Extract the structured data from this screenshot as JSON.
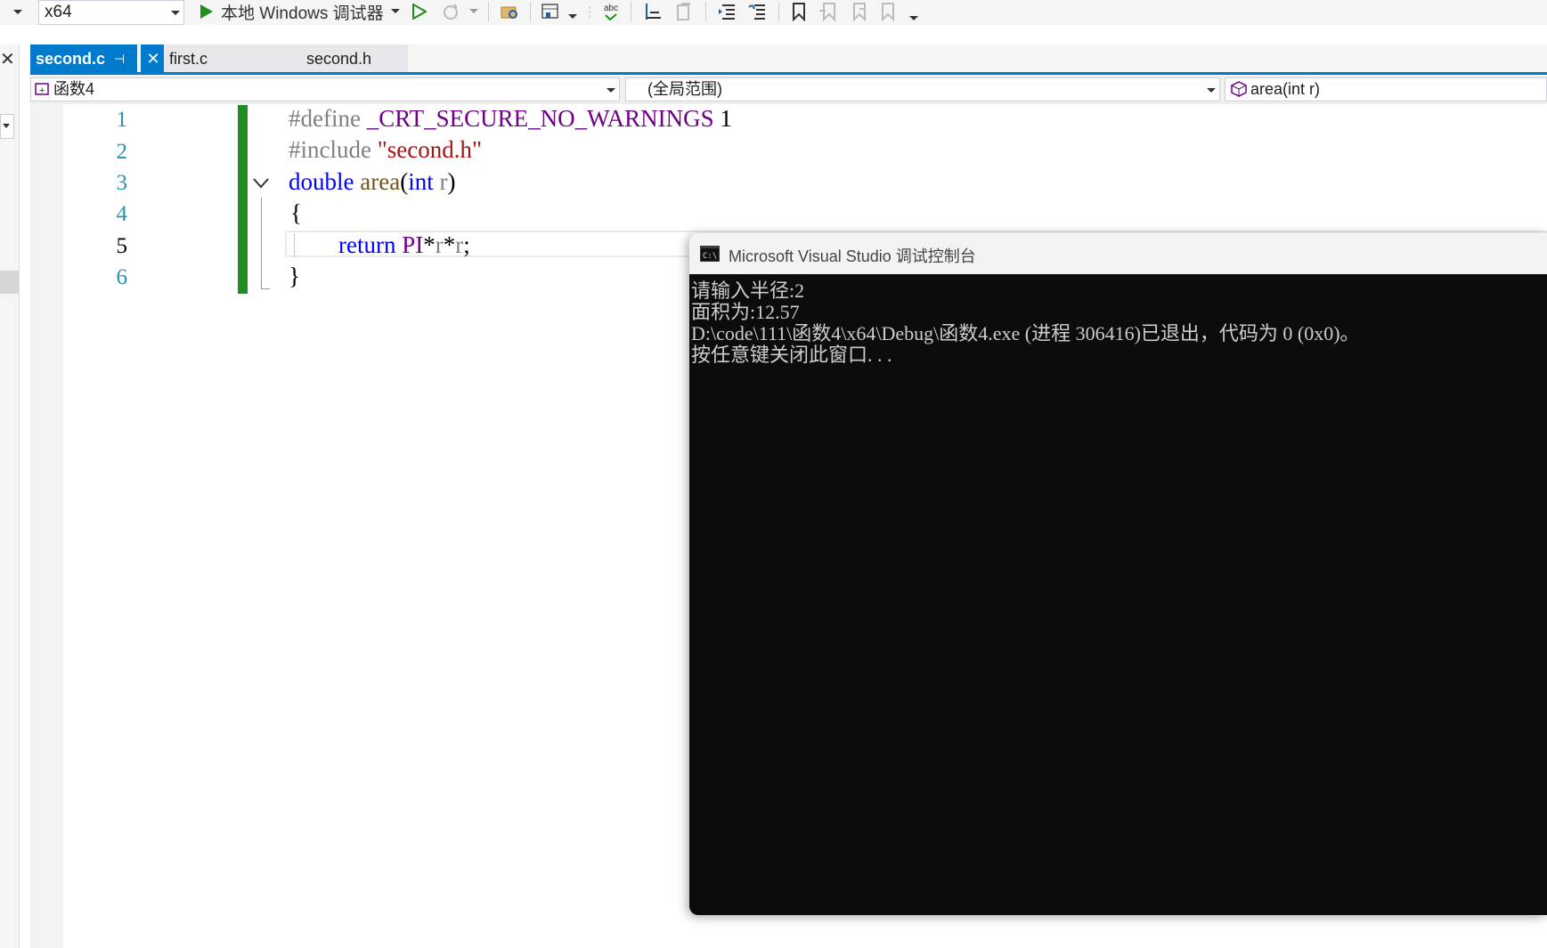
{
  "toolbar": {
    "platform": "x64",
    "run_label": "本地 Windows 调试器",
    "icons": [
      "run-icon",
      "start-without-debug-icon",
      "hot-reload-icon",
      "open-file-icon",
      "browse-icon",
      "spell-check-icon",
      "step-icon",
      "comment-icon",
      "indent-icon",
      "outdent-icon",
      "bookmark-icon",
      "prev-bookmark-icon",
      "next-bookmark-icon",
      "clear-bookmark-icon"
    ]
  },
  "tabs": [
    {
      "label": "second.c",
      "active": true
    },
    {
      "label": "first.c",
      "active": false
    },
    {
      "label": "second.h",
      "active": false
    }
  ],
  "navbar": {
    "project": "函数4",
    "scope": "(全局范围)",
    "member": "area(int r)"
  },
  "editor": {
    "line_numbers": [
      "1",
      "2",
      "3",
      "4",
      "5",
      "6"
    ],
    "current_line": 5,
    "code": {
      "l1_directive": "#define",
      "l1_macro": "_CRT_SECURE_NO_WARNINGS",
      "l1_value": "1",
      "l2_directive": "#include",
      "l2_string": "\"second.h\"",
      "l3_type": "double",
      "l3_fn": "area",
      "l3_open": "(",
      "l3_ptype": "int",
      "l3_param": "r",
      "l3_close": ")",
      "l4_brace": "{",
      "l5_kw": "return",
      "l5_macro": "PI",
      "l5_op1": "*",
      "l5_r1": "r",
      "l5_op2": "*",
      "l5_r2": "r",
      "l5_semi": ";",
      "l6_brace": "}"
    }
  },
  "console": {
    "title": "Microsoft Visual Studio 调试控制台",
    "lines": [
      "请输入半径:2",
      "面积为:12.57",
      "D:\\code\\111\\函数4\\x64\\Debug\\函数4.exe (进程 306416)已退出，代码为 0 (0x0)。",
      "按任意键关闭此窗口. . ."
    ]
  },
  "colors": {
    "accent": "#007acc",
    "change_bar": "#1e8e1e",
    "keyword": "#0000ff",
    "macro": "#6f008a",
    "string": "#a31515",
    "console_bg": "#0c0c0c"
  }
}
